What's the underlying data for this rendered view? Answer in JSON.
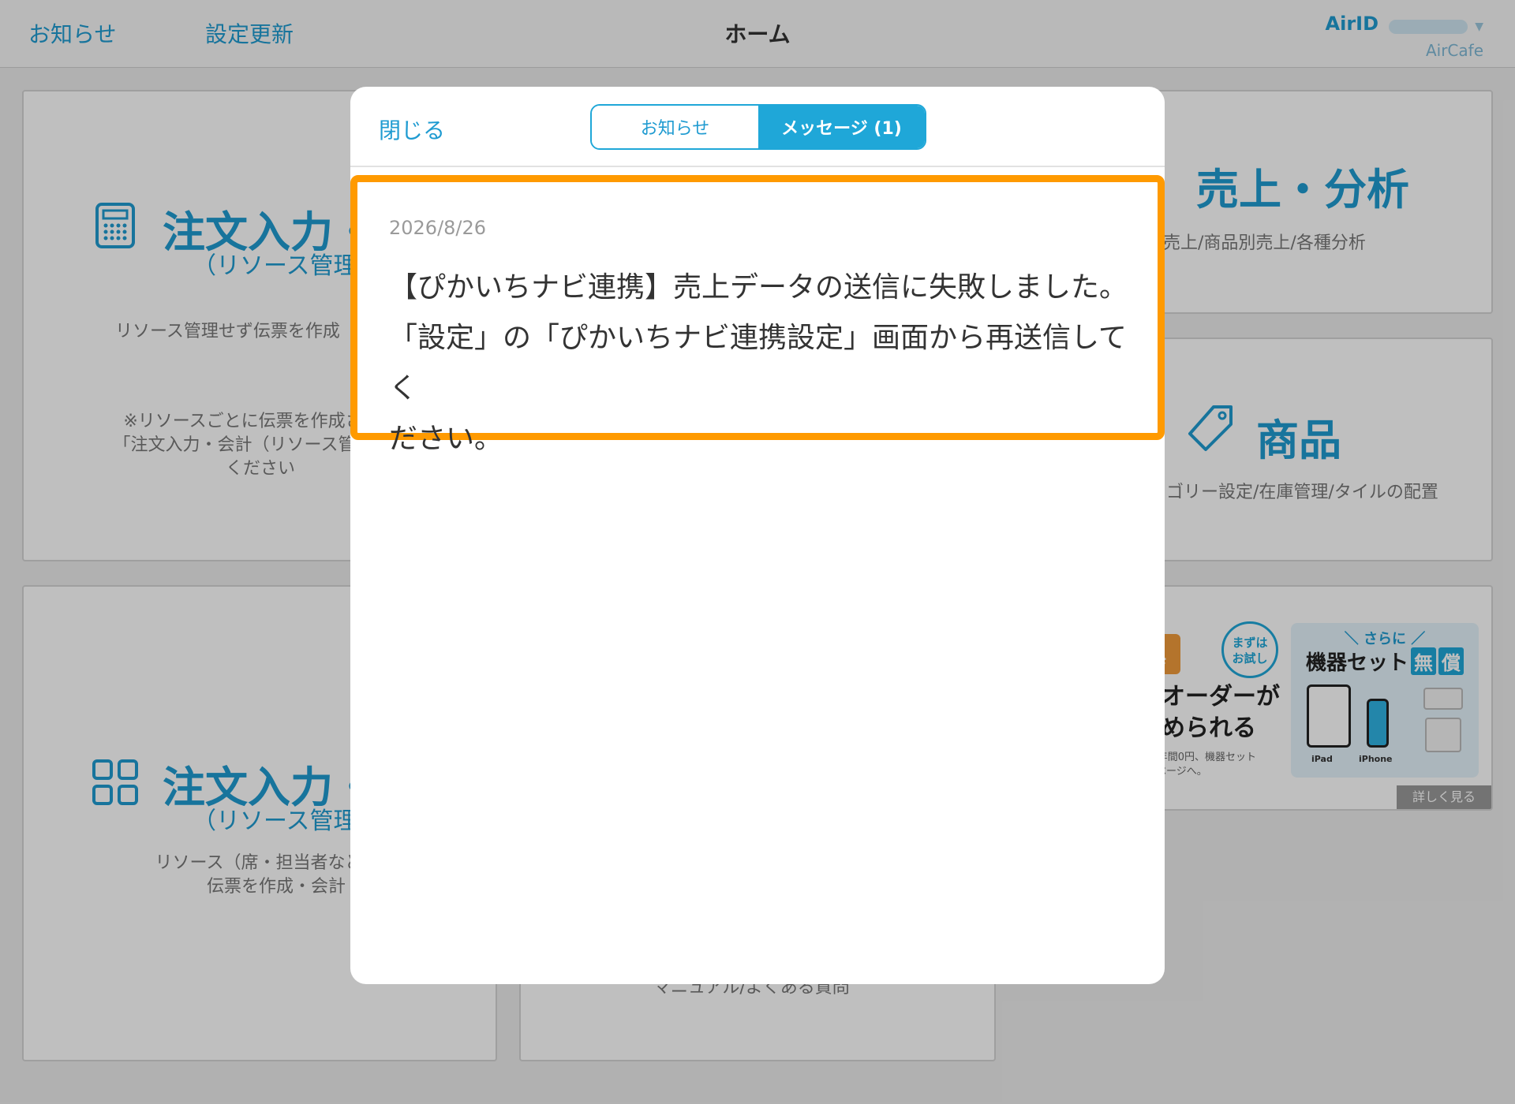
{
  "header": {
    "left_links": [
      "お知らせ",
      "設定更新"
    ],
    "title": "ホーム",
    "airid_label": "AirID",
    "store_name": "AirCafe"
  },
  "cards": {
    "order_entry_no_resource": {
      "title": "注文入力・",
      "subtitle": "（リソース管理",
      "desc": "リソース管理せず伝票を作成",
      "note_lines": [
        "※リソースごとに伝票を作成される",
        "「注文入力・会計（リソース管理あり",
        "ください"
      ]
    },
    "order_entry_resource": {
      "title": "注文入力・",
      "subtitle": "（リソース管理あ",
      "desc_lines": [
        "リソース（席・担当者など）こ",
        "伝票を作成・会計"
      ]
    },
    "sales_analysis": {
      "title": "売上・分析",
      "desc": "売上/商品別売上/各種分析"
    },
    "products": {
      "title": "商品",
      "desc": "ゴリー設定/在庫管理/タイルの配置"
    },
    "help": {
      "desc": "マニュアル/よくある質問"
    },
    "promo": {
      "badge": "特典",
      "circle": [
        "まずは",
        "お試し"
      ],
      "main_lines": [
        "ルオーダーが",
        "じめられる"
      ],
      "fine_lines": [
        "ﾒ1年間0円、機器セット",
        "典ページへ。"
      ],
      "box_top": "＼ さらに ／",
      "box_main": "機器セット",
      "free_chars": [
        "無",
        "償"
      ],
      "device_labels": [
        "iPad",
        "iPhone"
      ],
      "more": "詳しく見る"
    }
  },
  "modal": {
    "close_label": "閉じる",
    "tabs": [
      {
        "label": "お知らせ",
        "active": false
      },
      {
        "label": "メッセージ (1)",
        "active": true
      }
    ],
    "message": {
      "date": "2026/8/26",
      "lines": [
        "【ぴかいちナビ連携】売上データの送信に失敗しました。",
        "「設定」の「ぴかいちナビ連携設定」画面から再送信してく",
        "ださい。"
      ]
    }
  },
  "colors": {
    "accent": "#1fa7d8",
    "highlight": "#ff9a00",
    "promo_orange": "#f19b3b"
  },
  "icons": {
    "calculator": "calculator-icon",
    "grid": "grid-icon",
    "tag": "tag-icon",
    "chart": "chart-icon"
  }
}
